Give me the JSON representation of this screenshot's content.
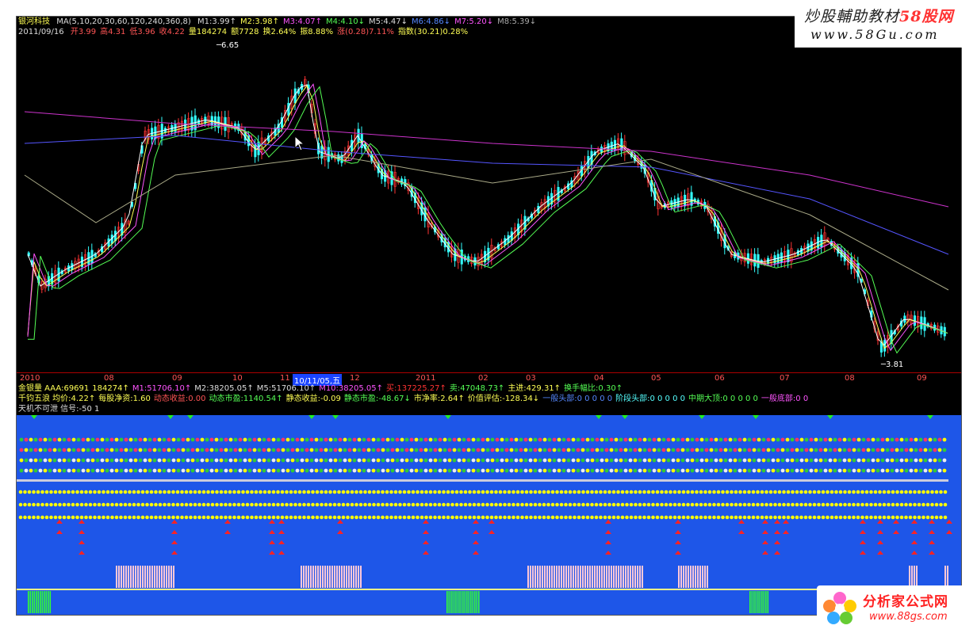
{
  "header": {
    "stock_name": "银河科技",
    "ma_params": "MA(5,10,20,30,60,120,240,360,8)",
    "ma_values": [
      {
        "label": "M1:3.99↑",
        "color": "#dddddd"
      },
      {
        "label": "M2:3.98↑",
        "color": "#ffff55"
      },
      {
        "label": "M3:4.07↑",
        "color": "#ff55ff"
      },
      {
        "label": "M4:4.10↓",
        "color": "#55ff55"
      },
      {
        "label": "M5:4.47↓",
        "color": "#dddddd"
      },
      {
        "label": "M6:4.86↓",
        "color": "#5588ff"
      },
      {
        "label": "M7:5.20↓",
        "color": "#ff55ff"
      },
      {
        "label": "M8:5.39↓",
        "color": "#aaaaaa"
      }
    ],
    "date": "2011/09/16",
    "quote": [
      {
        "label": "开3.99",
        "color": "#ff5555"
      },
      {
        "label": "高4.31",
        "color": "#ff5555"
      },
      {
        "label": "低3.96",
        "color": "#ff5555"
      },
      {
        "label": "收4.22",
        "color": "#ff5555"
      },
      {
        "label": "量184274",
        "color": "#ffff55"
      },
      {
        "label": "额7728",
        "color": "#ffff55"
      },
      {
        "label": "换2.64%",
        "color": "#ffff55"
      },
      {
        "label": "振8.88%",
        "color": "#ffff55"
      },
      {
        "label": "涨(0.28)7.11%",
        "color": "#ff5555"
      },
      {
        "label": "指数(30.21)0.28%",
        "color": "#ffff55"
      }
    ],
    "high_marker": "6.65",
    "low_marker": "3.81"
  },
  "x_axis": {
    "labels": [
      "2010",
      "08",
      "09",
      "10",
      "11",
      "12",
      "2011",
      "02",
      "03",
      "04",
      "05",
      "06",
      "07",
      "08",
      "09"
    ],
    "cursor_date": "10/11/05,五"
  },
  "indicators": {
    "line1": [
      {
        "label": "金银量 AAA:69691",
        "color": "#ffff55"
      },
      {
        "label": "184274↑",
        "color": "#ffff55"
      },
      {
        "label": "M1:51706.10↑",
        "color": "#ff55ff"
      },
      {
        "label": "M2:38205.05↑",
        "color": "#dddddd"
      },
      {
        "label": "M5:51706.10↑",
        "color": "#dddddd"
      },
      {
        "label": "M10:38205.05↑",
        "color": "#ff55ff"
      },
      {
        "label": "买:137225.27↑",
        "color": "#ff3333"
      },
      {
        "label": "卖:47048.73↑",
        "color": "#55ff55"
      },
      {
        "label": "主进:429.31↑",
        "color": "#ffff55"
      },
      {
        "label": "换手幅比:0.30↑",
        "color": "#55ff55"
      }
    ],
    "line2": [
      {
        "label": "千钧五浪 均价:4.22↑",
        "color": "#ffff55"
      },
      {
        "label": "每股净资:1.60",
        "color": "#ffff55"
      },
      {
        "label": "动态收益:0.00",
        "color": "#ff5555"
      },
      {
        "label": "动态市盈:1140.54↑",
        "color": "#55ff55"
      },
      {
        "label": "静态收益:-0.09",
        "color": "#ffff55"
      },
      {
        "label": "静态市盈:-48.67↓",
        "color": "#55ff55"
      },
      {
        "label": "市净率:2.64↑",
        "color": "#ffff55"
      },
      {
        "label": "价值评估:-128.34↓",
        "color": "#ffff55"
      },
      {
        "label": "一般头部:0 0 0 0 0",
        "color": "#5588ff"
      },
      {
        "label": "阶段头部:0 0 0 0 0",
        "color": "#55ffff"
      },
      {
        "label": "中期大顶:0 0 0 0 0",
        "color": "#55ff55"
      },
      {
        "label": "一般底部:0 0",
        "color": "#ff55ff"
      }
    ],
    "line3": [
      {
        "label": "天机不可泄 信号:-50 1",
        "color": "#dddddd"
      }
    ]
  },
  "watermark_top": {
    "title_main": "炒股輔助教材",
    "title_site": "58股网",
    "url": "www.58Gu.com"
  },
  "watermark_bottom": {
    "title": "分析家公式网",
    "url": "www.88gs.com"
  },
  "colors": {
    "background": "#000000",
    "panel": "#1e56e8",
    "up": "#ff3333",
    "down": "#33ffff"
  }
}
